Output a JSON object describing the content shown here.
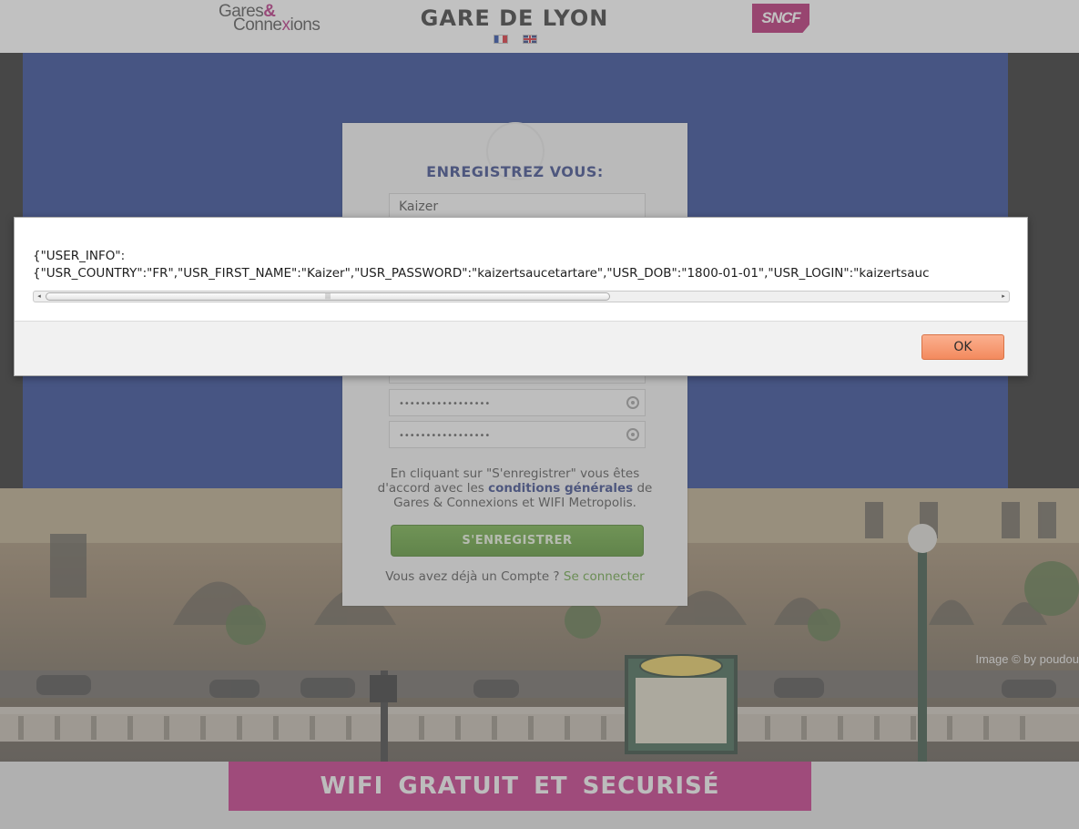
{
  "header": {
    "logo_line1": "Gares",
    "logo_amp": "&",
    "logo_line2_a": "Conne",
    "logo_line2_x": "x",
    "logo_line2_b": "ions",
    "station_title": "GARE DE LYON",
    "sncf_logo": "SNCF",
    "languages": [
      "fr-flag",
      "uk-flag"
    ]
  },
  "registration": {
    "title": "ENREGISTREZ VOUS:",
    "first_name_value": "Kaizer",
    "password_value": "•••••••••••••••••",
    "confirm_password_value": "•••••••••••••••••",
    "terms_prefix": "En cliquant sur \"S'enregistrer\" vous êtes d'accord avec les ",
    "terms_link": "conditions générales",
    "terms_suffix": " de Gares & Connexions et WIFI Metropolis.",
    "register_button": "S'ENREGISTRER",
    "login_prompt": "Vous avez déjà un Compte ? ",
    "login_link": "Se connecter"
  },
  "photo": {
    "credit": "Image © by poudou"
  },
  "banner": {
    "text": "WIFI GRATUIT ET SECURISÉ"
  },
  "dialog": {
    "message_line1": "{\"USER_INFO\":",
    "message_line2": "{\"USR_COUNTRY\":\"FR\",\"USR_FIRST_NAME\":\"Kaizer\",\"USR_PASSWORD\":\"kaizertsaucetartare\",\"USR_DOB\":\"1800-01-01\",\"USR_LOGIN\":\"kaizertsauc",
    "ok_label": "OK",
    "scroll_left_glyph": "◂",
    "scroll_right_glyph": "▸",
    "scroll_thumb_grip": "|||"
  },
  "colors": {
    "brand_magenta": "#c0277f",
    "panel_blue": "#1f3a8c",
    "accent_green": "#5f9e37",
    "ok_orange": "#f38a5e"
  }
}
